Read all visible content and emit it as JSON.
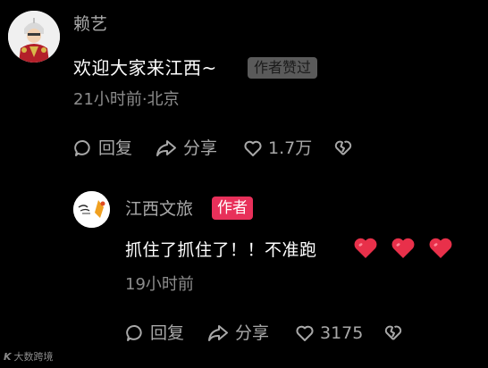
{
  "main_comment": {
    "username": "赖艺",
    "text": "欢迎大家来江西~",
    "author_liked_badge": "作者赞过",
    "meta": "21小时前·北京",
    "actions": {
      "reply": "回复",
      "share": "分享",
      "likes": "1.7万"
    }
  },
  "reply_comment": {
    "username": "江西文旅",
    "author_badge": "作者",
    "text": "抓住了抓住了！！不准跑",
    "emojis": [
      "red-heart",
      "red-heart",
      "red-heart"
    ],
    "meta": "19小时前",
    "actions": {
      "reply": "回复",
      "share": "分享",
      "likes": "3175"
    }
  },
  "watermark": {
    "logo": "K",
    "text": "大数跨境"
  },
  "colors": {
    "background": "#000000",
    "secondary_text": "#a8a8a8",
    "author_badge": "#e8305a",
    "liked_badge": "#5a5a5a",
    "heart": "#e8304a"
  }
}
